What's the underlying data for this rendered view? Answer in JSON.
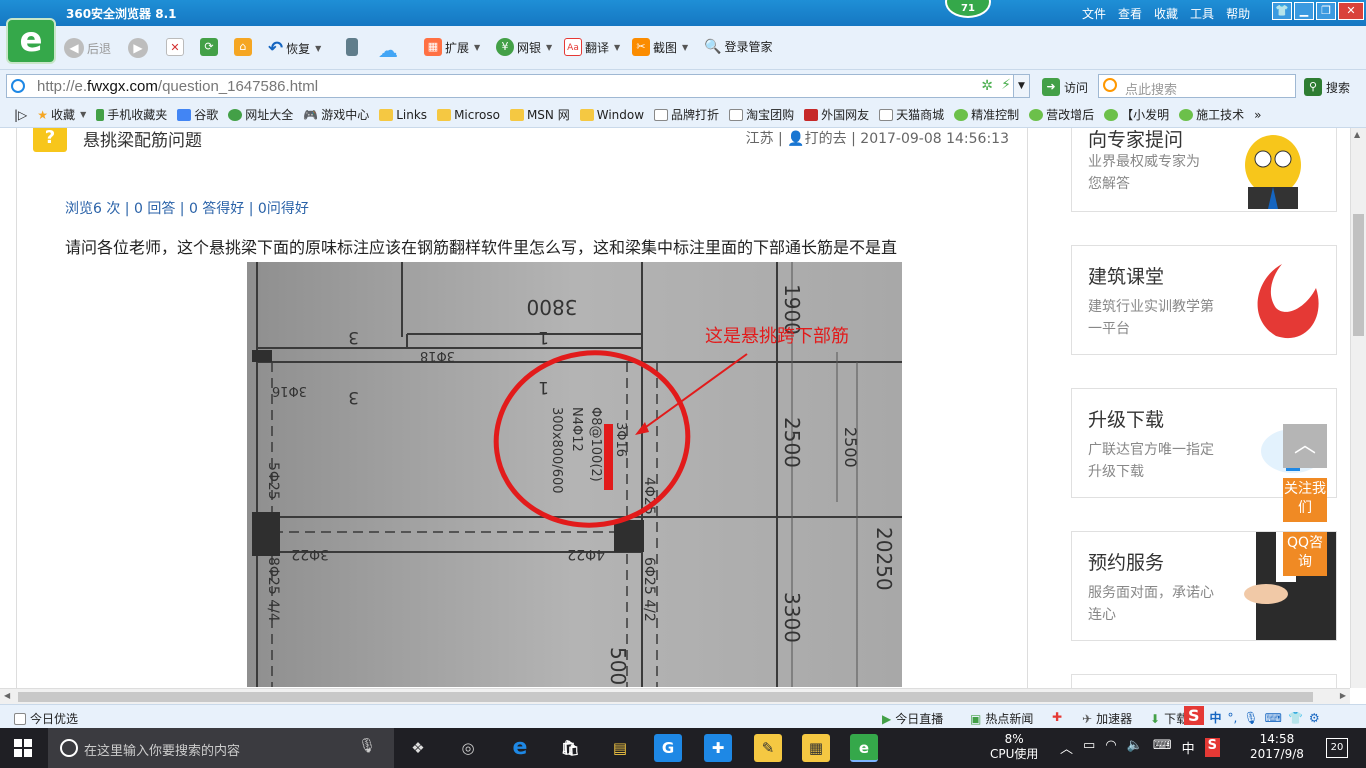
{
  "window": {
    "title": "360安全浏览器 8.1",
    "badge": "71",
    "menus": [
      "文件",
      "查看",
      "收藏",
      "工具",
      "帮助"
    ]
  },
  "toolbar": {
    "back": "后退",
    "restore": "恢复",
    "extend": "扩展",
    "bank": "网银",
    "translate": "翻译",
    "screenshot": "截图",
    "login_manager": "登录管家"
  },
  "address": {
    "url_prefix": "http://e.",
    "url_domain": "fwxgx.com",
    "url_path": "/question_1647586.html",
    "visit": "访问",
    "search_placeholder": "点此搜索",
    "search_button": "搜索"
  },
  "bookmarks": [
    "收藏",
    "手机收藏夹",
    "谷歌",
    "网址大全",
    "游戏中心",
    "Links",
    "Microso",
    "MSN 网",
    "Window",
    "品牌打折",
    "淘宝团购",
    "外国网友",
    "天猫商城",
    "精准控制",
    "营改增后",
    "【小发明",
    "施工技术"
  ],
  "question": {
    "title": "悬挑梁配筋问题",
    "meta_location": "江苏",
    "meta_user": "打的去",
    "meta_time": "2017-09-08 14:56:13",
    "stats": "浏览6 次 | 0 回答 | 0 答得好 | 0问得好",
    "body": "请问各位老师，这个悬挑梁下面的原味标注应该在钢筋翻样软件里怎么写，这和梁集中标注里面的下部通长筋是不是直",
    "image": {
      "annotation": "这是悬挑跨下部筋",
      "dim_top": "3800",
      "dim_right1": "1900",
      "dim_right2": "2500",
      "dim_right3": "2500",
      "dim_right4": "20250",
      "dim_right5": "3300",
      "dim_bottom": "500",
      "beam_stirrup": "Φ8@100(2)",
      "beam_side": "N4Φ12",
      "beam_size": "300x800/600",
      "beam_top": "3Φ16",
      "label_3_1": "3",
      "label_3_2": "3",
      "label_1_1": "1",
      "label_1_2": "1",
      "rebar_318": "3Φ18",
      "rebar_316": "3Φ16",
      "rebar_525": "5Φ25",
      "rebar_425": "4Φ25",
      "rebar_322": "3Φ22",
      "rebar_422": "4Φ22",
      "rebar_825": "8Φ25 4/4",
      "rebar_625": "6Φ25 4/2"
    }
  },
  "sidebar": {
    "expert": {
      "title": "向专家提问",
      "desc": "业界最权威专家为您解答"
    },
    "class": {
      "title": "建筑课堂",
      "desc": "建筑行业实训教学第一平台"
    },
    "upgrade": {
      "title": "升级下载",
      "desc": "广联达官方唯一指定升级下载"
    },
    "booking": {
      "title": "预约服务",
      "desc": "服务面对面，承诺心连心"
    }
  },
  "float": {
    "follow": "关注我们",
    "qq": "QQ咨询"
  },
  "statusbar": {
    "today": "今日优选",
    "live": "今日直播",
    "news": "热点新闻",
    "accelerator": "加速器",
    "download": "下载"
  },
  "taskbar": {
    "search_placeholder": "在这里输入你要搜索的内容",
    "cpu_value": "8%",
    "cpu_label": "CPU使用",
    "ime": "中",
    "time": "14:58",
    "date": "2017/9/8",
    "notifications": "20"
  },
  "colors": {
    "title_blue": "#1f8fd6",
    "annotation_red": "#e21b1b",
    "orange": "#f08a24",
    "stats_blue": "#2a62a8"
  }
}
